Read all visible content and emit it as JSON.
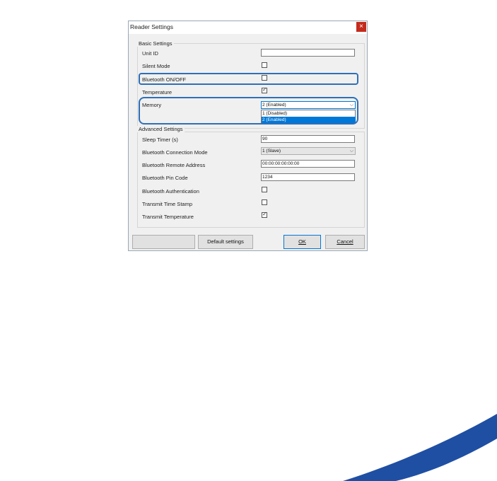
{
  "window": {
    "title": "Reader Settings",
    "close_glyph": "×"
  },
  "basic": {
    "label": "Basic Settings",
    "unit_id": {
      "label": "Unit ID",
      "value": ""
    },
    "silent_mode": {
      "label": "Silent Mode",
      "checked": false
    },
    "bluetooth": {
      "label": "Bluetooth ON/OFF",
      "checked": false
    },
    "temperature": {
      "label": "Temperature",
      "checked": true
    },
    "memory": {
      "label": "Memory",
      "selected": "2 (Enabled)",
      "options": [
        "1 (Disabled)",
        "2 (Enabled)"
      ]
    }
  },
  "advanced": {
    "label": "Advanced Settings",
    "sleep_timer": {
      "label": "Sleep Timer (s)",
      "value": "90"
    },
    "conn_mode": {
      "label": "Bluetooth Connection Mode",
      "selected": "1 (Slave)"
    },
    "remote_address": {
      "label": "Bluetooth Remote Address",
      "value": "00:00:00:00:00:00"
    },
    "pin_code": {
      "label": "Bluetooth Pin Code",
      "value": "1234"
    },
    "authentication": {
      "label": "Bluetooth Authentication",
      "checked": false
    },
    "time_stamp": {
      "label": "Transmit Time Stamp",
      "checked": false
    },
    "transmit_temperature": {
      "label": "Transmit Temperature",
      "checked": true
    }
  },
  "buttons": {
    "default": "Default settings",
    "ok": "OK",
    "cancel": "Cancel"
  },
  "colors": {
    "accent": "#0078d7",
    "highlight": "#2f6fb8",
    "swoosh": "#1f4fa3",
    "close": "#c42b1c"
  }
}
